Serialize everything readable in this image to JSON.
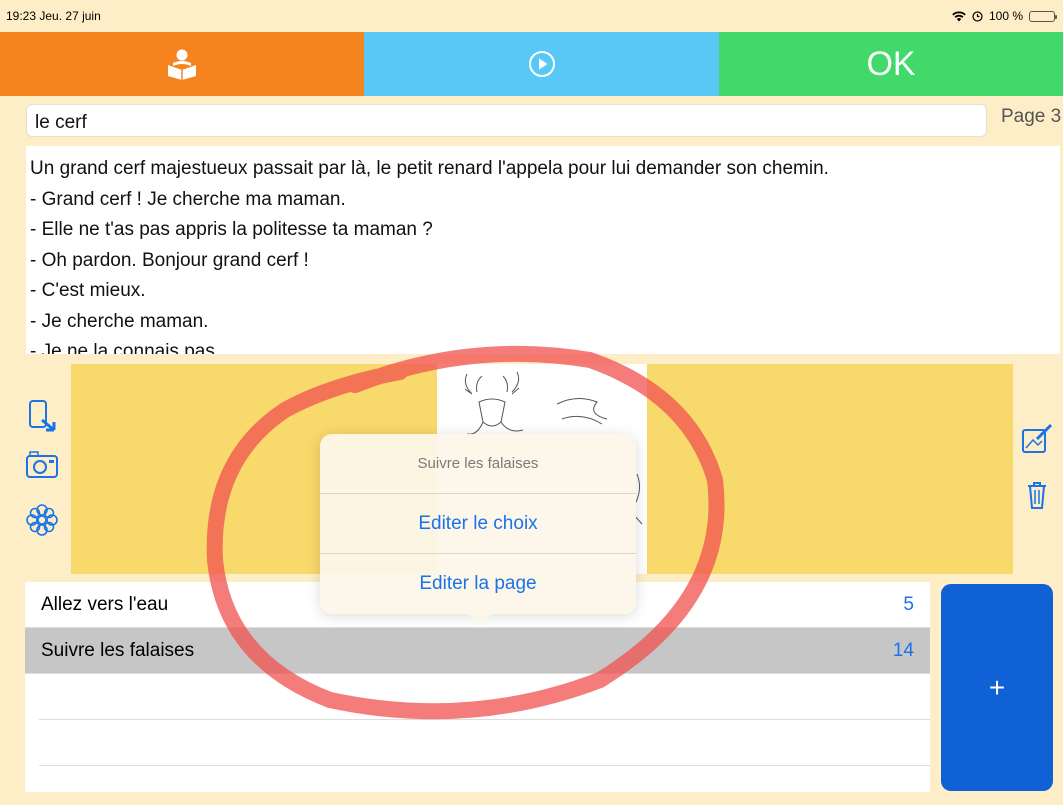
{
  "status": {
    "time": "19:23",
    "date": "Jeu. 27 juin",
    "battery": "100 %"
  },
  "toolbar": {
    "ok_label": "OK"
  },
  "page": {
    "title": "le cerf",
    "page_label": "Page 3"
  },
  "story": {
    "lines": [
      "Un grand cerf majestueux passait par là, le petit renard l'appela pour lui demander son chemin.",
      "- Grand cerf ! Je cherche ma maman.",
      "- Elle ne t'as pas appris la politesse ta maman ?",
      "- Oh pardon. Bonjour grand cerf !",
      "- C'est mieux.",
      "- Je cherche maman.",
      "- Je ne la connais pas."
    ]
  },
  "choices": [
    {
      "label": "Allez vers l'eau",
      "page": "5"
    },
    {
      "label": "Suivre les falaises",
      "page": "14"
    }
  ],
  "add_label": "+",
  "popover": {
    "title": "Suivre les falaises",
    "edit_choice": "Editer le choix",
    "edit_page": "Editer la page"
  },
  "colors": {
    "toolbar_orange": "#f5841f",
    "toolbar_blue": "#5ac8f7",
    "toolbar_green": "#41d96a",
    "accent_blue": "#1a73e8",
    "add_button": "#1060d6",
    "image_bg": "#f8d96b",
    "annotation_red": "#f0504f"
  },
  "icons": [
    "wifi-icon",
    "alarm-icon",
    "battery-icon",
    "reader-icon",
    "play-icon",
    "import-icon",
    "camera-icon",
    "flower-icon",
    "edit-image-icon",
    "trash-icon"
  ]
}
